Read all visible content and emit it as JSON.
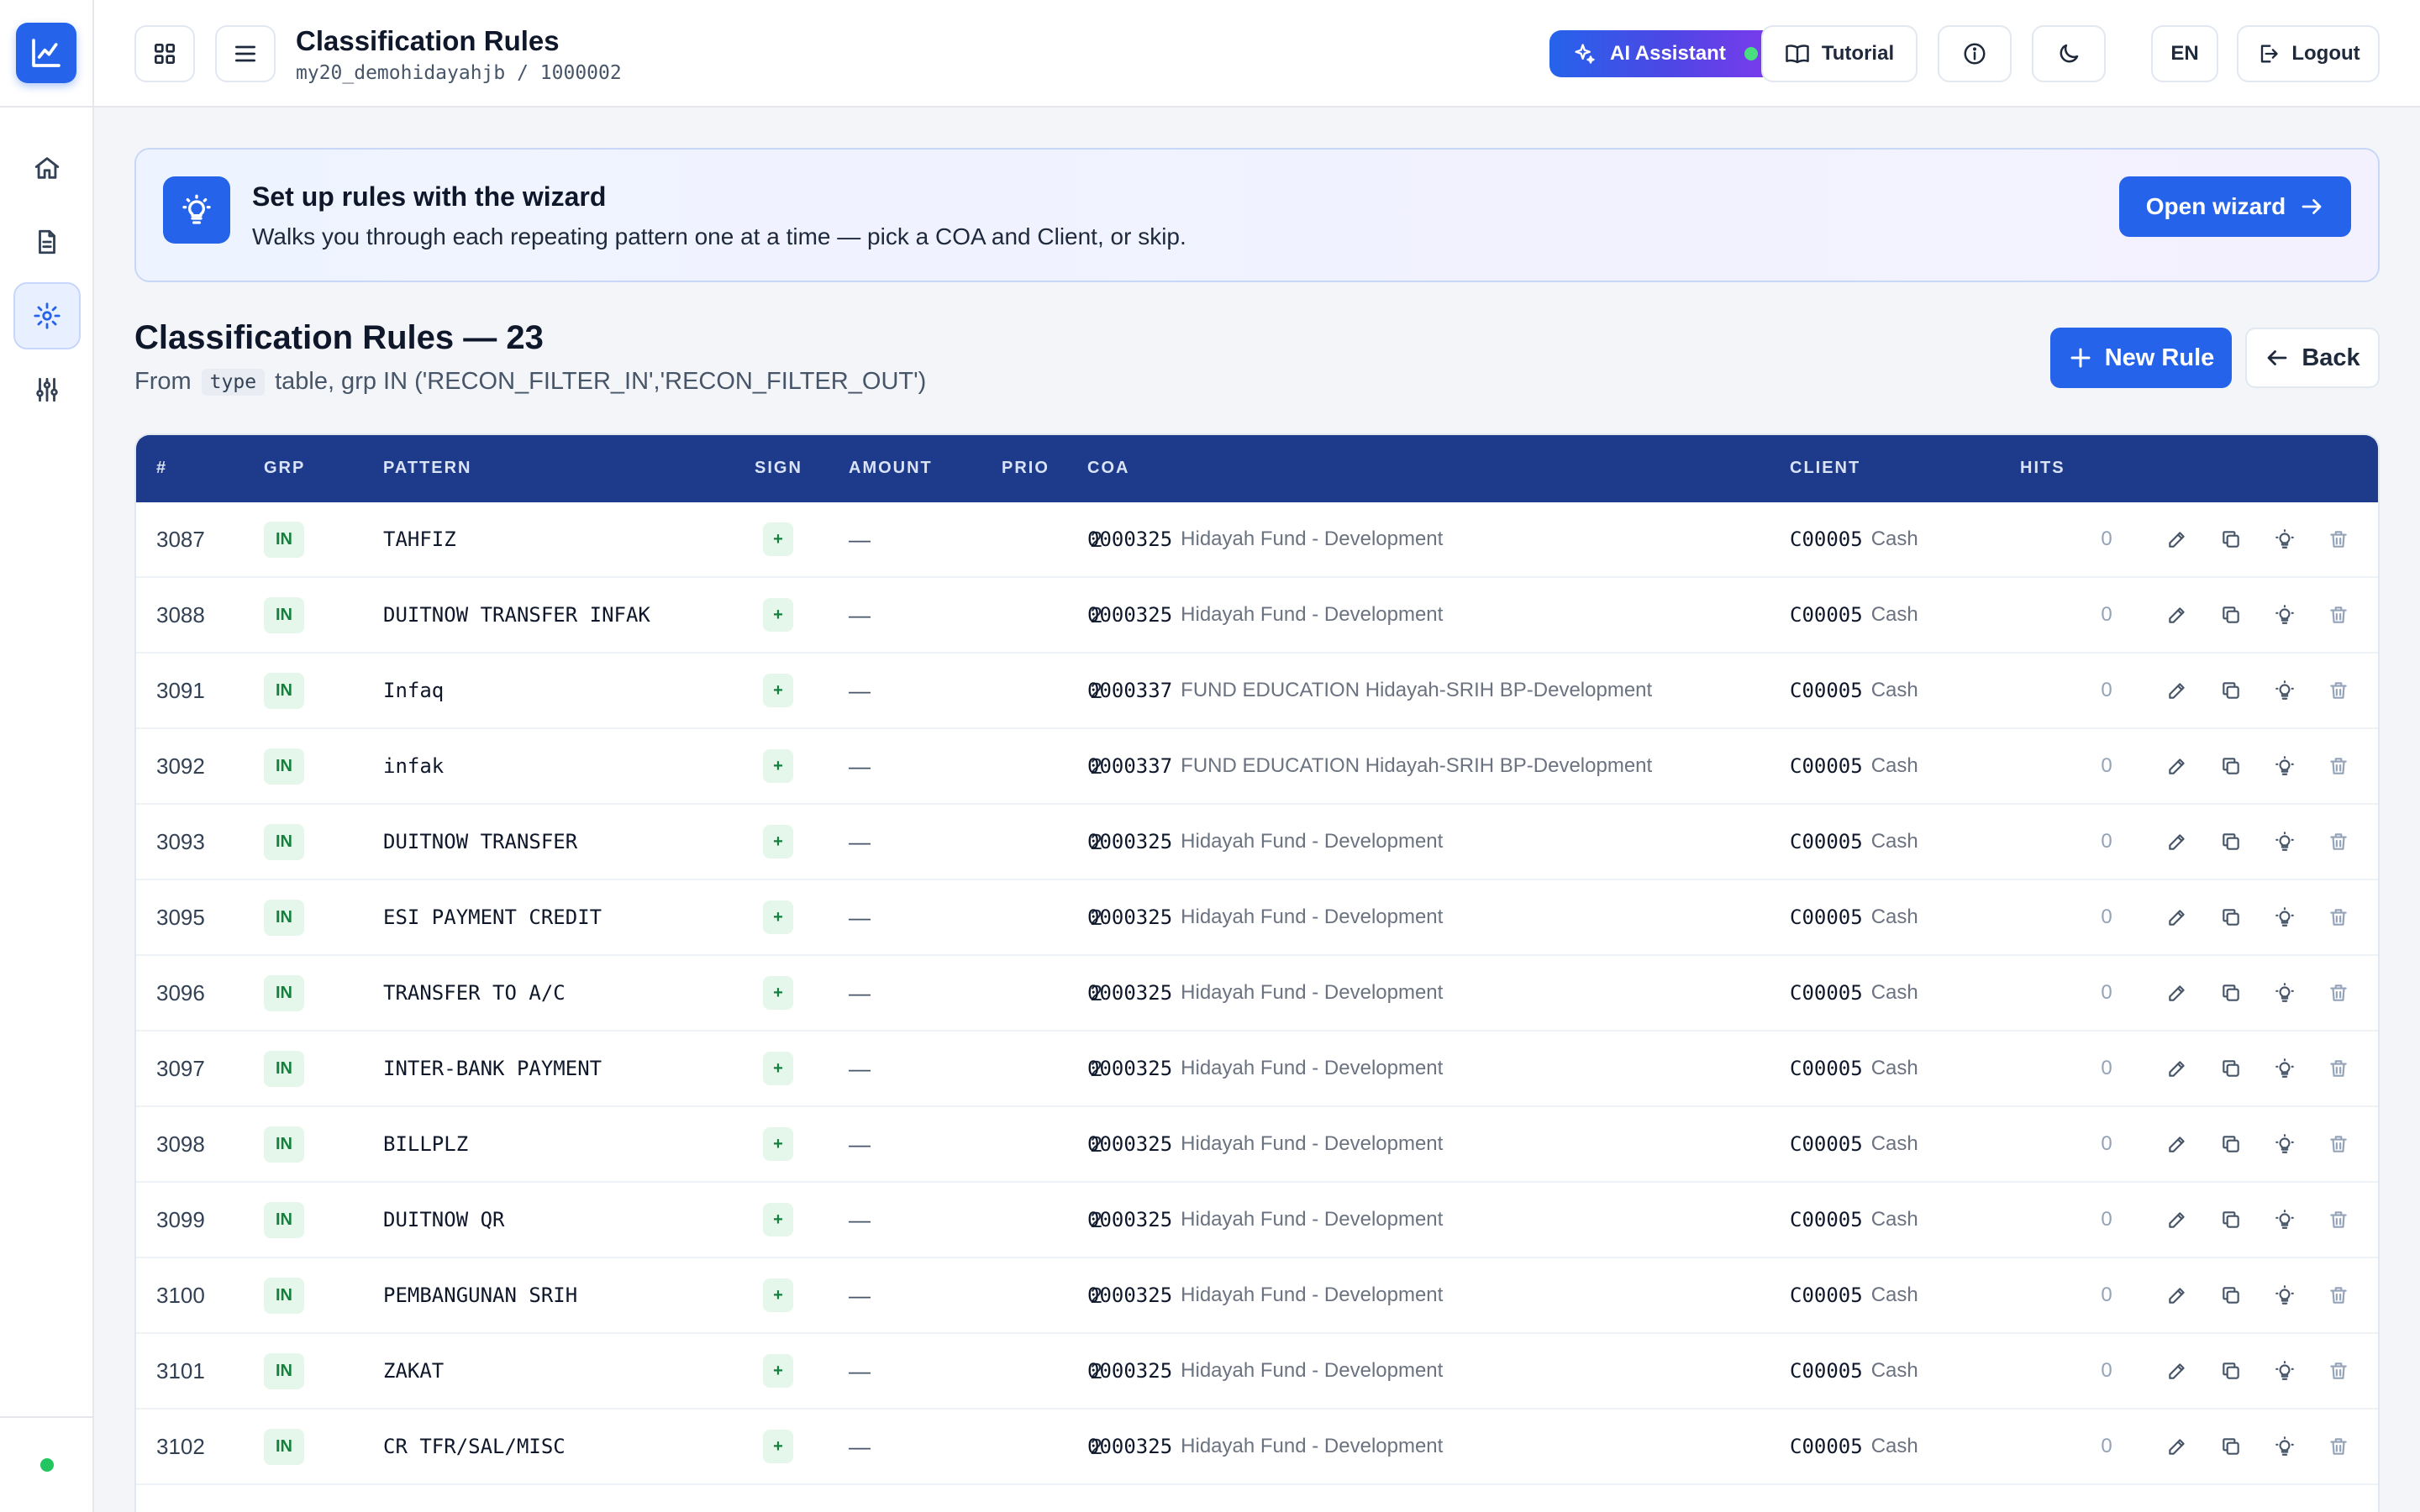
{
  "header": {
    "title": "Classification Rules",
    "subtitle": "my20_demohidayahjb / 1000002",
    "ai_label": "AI Assistant",
    "tutorial_label": "Tutorial",
    "lang_label": "EN",
    "logout_label": "Logout"
  },
  "banner": {
    "title": "Set up rules with the wizard",
    "description": "Walks you through each repeating pattern one at a time — pick a COA and Client, or skip.",
    "button_label": "Open wizard"
  },
  "section": {
    "title": "Classification Rules — 23",
    "sub_prefix": "From",
    "sub_code": "type",
    "sub_suffix": "table, grp IN ('RECON_FILTER_IN','RECON_FILTER_OUT')",
    "new_rule_label": "New Rule",
    "back_label": "Back"
  },
  "table": {
    "columns": [
      "#",
      "GRP",
      "PATTERN",
      "SIGN",
      "AMOUNT",
      "PRIO",
      "COA",
      "CLIENT",
      "HITS"
    ],
    "rows": [
      {
        "id": "3087",
        "grp": "IN",
        "pattern": "TAHFIZ",
        "sign": "+",
        "amount": "—",
        "prio": "2",
        "coa_code": "0000325",
        "coa_name": "Hidayah Fund - Development",
        "client_code": "C00005",
        "client_name": "Cash",
        "hits": "0"
      },
      {
        "id": "3088",
        "grp": "IN",
        "pattern": "DUITNOW TRANSFER INFAK",
        "sign": "+",
        "amount": "—",
        "prio": "2",
        "coa_code": "0000325",
        "coa_name": "Hidayah Fund - Development",
        "client_code": "C00005",
        "client_name": "Cash",
        "hits": "0"
      },
      {
        "id": "3091",
        "grp": "IN",
        "pattern": "Infaq",
        "sign": "+",
        "amount": "—",
        "prio": "2",
        "coa_code": "0000337",
        "coa_name": "FUND EDUCATION Hidayah-SRIH BP-Development",
        "client_code": "C00005",
        "client_name": "Cash",
        "hits": "0"
      },
      {
        "id": "3092",
        "grp": "IN",
        "pattern": "infak",
        "sign": "+",
        "amount": "—",
        "prio": "2",
        "coa_code": "0000337",
        "coa_name": "FUND EDUCATION Hidayah-SRIH BP-Development",
        "client_code": "C00005",
        "client_name": "Cash",
        "hits": "0"
      },
      {
        "id": "3093",
        "grp": "IN",
        "pattern": "DUITNOW TRANSFER",
        "sign": "+",
        "amount": "—",
        "prio": "2",
        "coa_code": "0000325",
        "coa_name": "Hidayah Fund - Development",
        "client_code": "C00005",
        "client_name": "Cash",
        "hits": "0"
      },
      {
        "id": "3095",
        "grp": "IN",
        "pattern": "ESI PAYMENT CREDIT",
        "sign": "+",
        "amount": "—",
        "prio": "2",
        "coa_code": "0000325",
        "coa_name": "Hidayah Fund - Development",
        "client_code": "C00005",
        "client_name": "Cash",
        "hits": "0"
      },
      {
        "id": "3096",
        "grp": "IN",
        "pattern": "TRANSFER TO A/C",
        "sign": "+",
        "amount": "—",
        "prio": "2",
        "coa_code": "0000325",
        "coa_name": "Hidayah Fund - Development",
        "client_code": "C00005",
        "client_name": "Cash",
        "hits": "0"
      },
      {
        "id": "3097",
        "grp": "IN",
        "pattern": "INTER-BANK PAYMENT",
        "sign": "+",
        "amount": "—",
        "prio": "2",
        "coa_code": "0000325",
        "coa_name": "Hidayah Fund - Development",
        "client_code": "C00005",
        "client_name": "Cash",
        "hits": "0"
      },
      {
        "id": "3098",
        "grp": "IN",
        "pattern": "BILLPLZ",
        "sign": "+",
        "amount": "—",
        "prio": "2",
        "coa_code": "0000325",
        "coa_name": "Hidayah Fund - Development",
        "client_code": "C00005",
        "client_name": "Cash",
        "hits": "0"
      },
      {
        "id": "3099",
        "grp": "IN",
        "pattern": "DUITNOW QR",
        "sign": "+",
        "amount": "—",
        "prio": "2",
        "coa_code": "0000325",
        "coa_name": "Hidayah Fund - Development",
        "client_code": "C00005",
        "client_name": "Cash",
        "hits": "0"
      },
      {
        "id": "3100",
        "grp": "IN",
        "pattern": "PEMBANGUNAN SRIH",
        "sign": "+",
        "amount": "—",
        "prio": "2",
        "coa_code": "0000325",
        "coa_name": "Hidayah Fund - Development",
        "client_code": "C00005",
        "client_name": "Cash",
        "hits": "0"
      },
      {
        "id": "3101",
        "grp": "IN",
        "pattern": "ZAKAT",
        "sign": "+",
        "amount": "—",
        "prio": "2",
        "coa_code": "0000325",
        "coa_name": "Hidayah Fund - Development",
        "client_code": "C00005",
        "client_name": "Cash",
        "hits": "0"
      },
      {
        "id": "3102",
        "grp": "IN",
        "pattern": "CR TFR/SAL/MISC",
        "sign": "+",
        "amount": "—",
        "prio": "2",
        "coa_code": "0000325",
        "coa_name": "Hidayah Fund - Development",
        "client_code": "C00005",
        "client_name": "Cash",
        "hits": "0"
      }
    ]
  },
  "icons": {
    "logo": "chart-line-icon",
    "sidebar": [
      "home-icon",
      "document-icon",
      "gear-icon",
      "sliders-icon"
    ],
    "row_actions": [
      "edit-icon",
      "copy-icon",
      "lightbulb-icon",
      "trash-icon"
    ]
  },
  "colors": {
    "primary": "#2563eb",
    "table_header": "#1e3a8a",
    "badge_green": "#15803d",
    "status_online": "#22c55e"
  }
}
